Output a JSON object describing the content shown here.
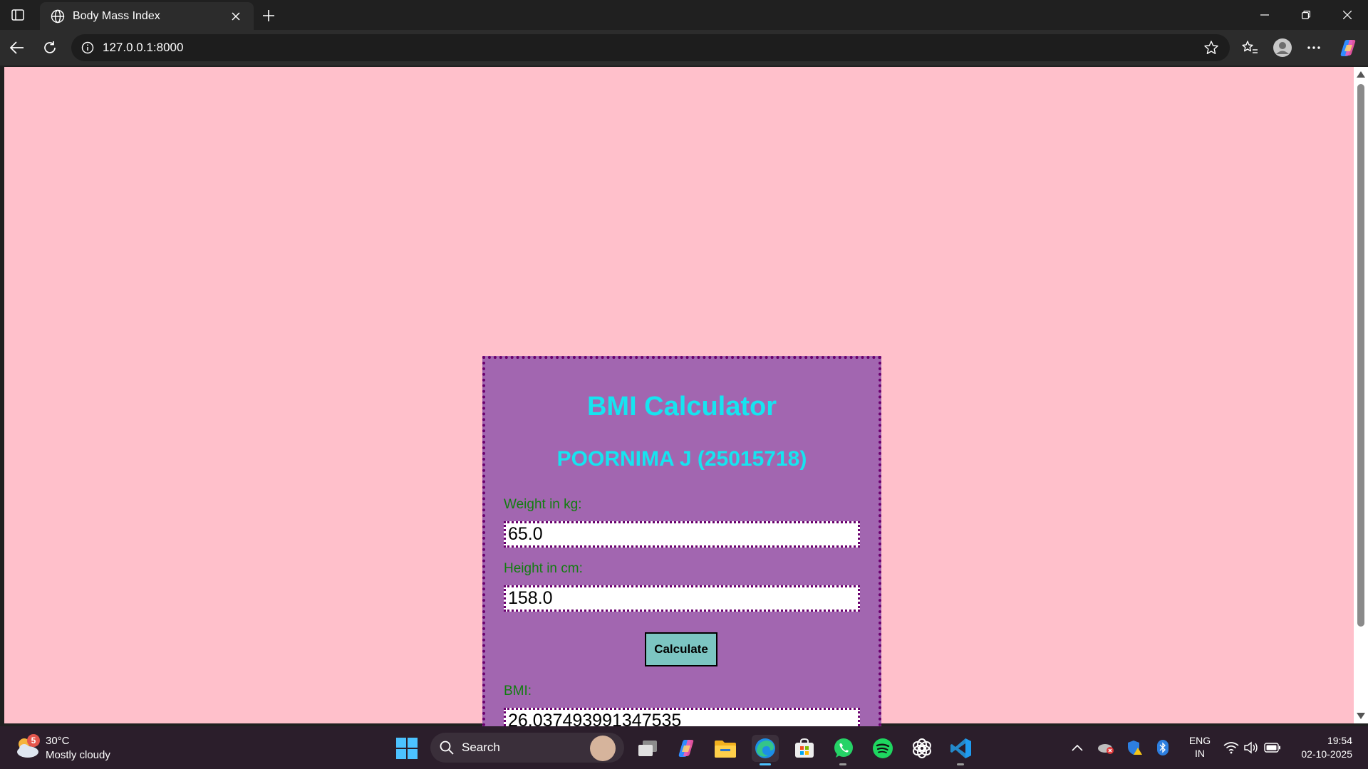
{
  "browser": {
    "tab_title": "Body Mass Index",
    "url": "127.0.0.1:8000"
  },
  "page": {
    "heading": "BMI Calculator",
    "subheading": "POORNIMA J (25015718)",
    "weight_label": "Weight in kg:",
    "weight_value": "65.0",
    "height_label": "Height in cm:",
    "height_value": "158.0",
    "calculate_label": "Calculate",
    "bmi_label": "BMI:",
    "bmi_value": "26.037493991347535",
    "colors": {
      "background": "#ffc0cb",
      "card": "#a266b0",
      "heading": "#16e4f0",
      "labels": "#127d10",
      "button": "#7cc5c2"
    }
  },
  "taskbar": {
    "weather_badge": "5",
    "temperature": "30°C",
    "condition": "Mostly cloudy",
    "search_placeholder": "Search",
    "lang_line1": "ENG",
    "lang_line2": "IN",
    "time": "19:54",
    "date": "02-10-2025",
    "pinned_icons": [
      "task-view-icon",
      "copilot-icon",
      "file-explorer-icon",
      "edge-icon",
      "store-icon",
      "whatsapp-icon",
      "spotify-icon",
      "chatgpt-icon",
      "vscode-icon"
    ]
  }
}
